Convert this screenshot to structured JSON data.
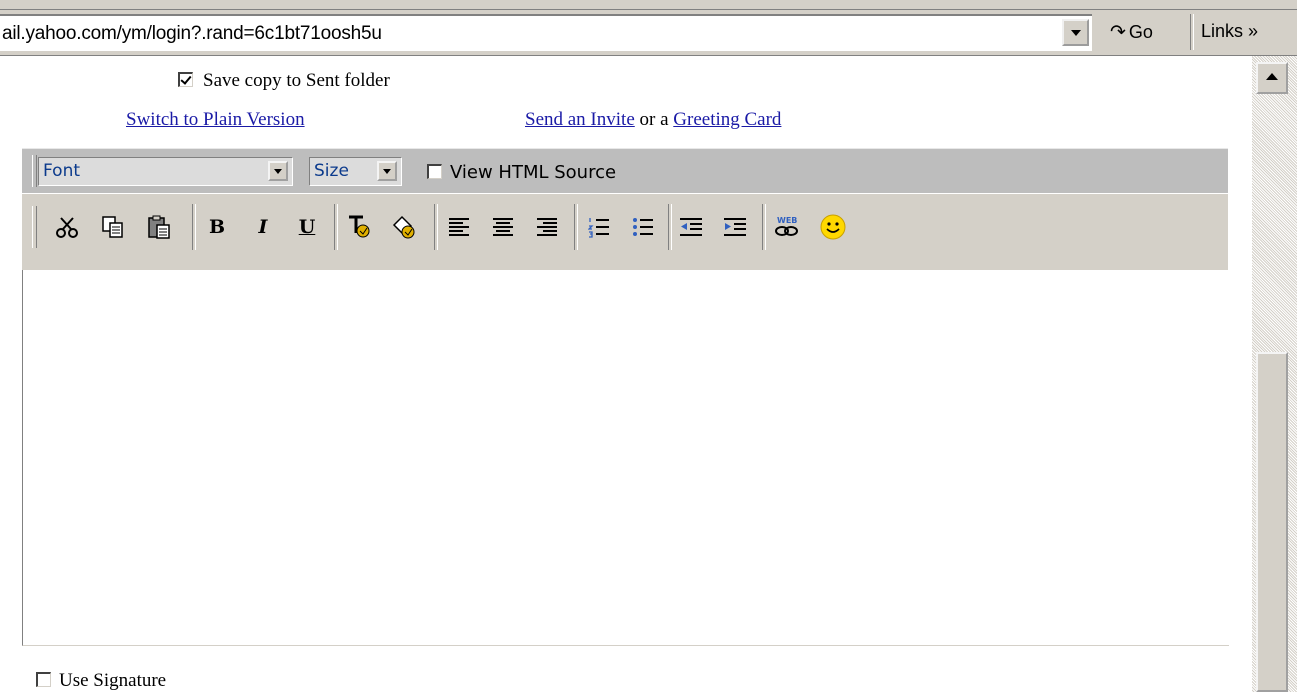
{
  "browser": {
    "address": "ail.yahoo.com/ym/login?.rand=6c1bt71oosh5u",
    "go_label": "Go",
    "links_label": "Links »"
  },
  "compose": {
    "save_copy_label": "Save copy to Sent folder",
    "save_copy_checked": true,
    "switch_plain_label": "Switch to Plain Version",
    "send_invite_label": "Send an Invite",
    "or_a_text": " or a ",
    "greeting_card_label": "Greeting Card",
    "font_select": "Font",
    "size_select": "Size",
    "view_html_label": "View HTML Source",
    "bold_label": "B",
    "italic_label": "I",
    "underline_label": "U",
    "use_signature_label": "Use Signature"
  },
  "colors": {
    "link": "#1a1aa6",
    "toolbar_top": "#bdbdbd",
    "toolbar_bottom": "#d4d0c8",
    "select_text": "#0b3a8c"
  },
  "icons": [
    "cut-icon",
    "copy-icon",
    "paste-icon",
    "bold-icon",
    "italic-icon",
    "underline-icon",
    "text-color-icon",
    "highlight-icon",
    "align-left-icon",
    "align-center-icon",
    "align-right-icon",
    "numbered-list-icon",
    "bulleted-list-icon",
    "outdent-icon",
    "indent-icon",
    "web-link-icon",
    "smiley-icon"
  ]
}
